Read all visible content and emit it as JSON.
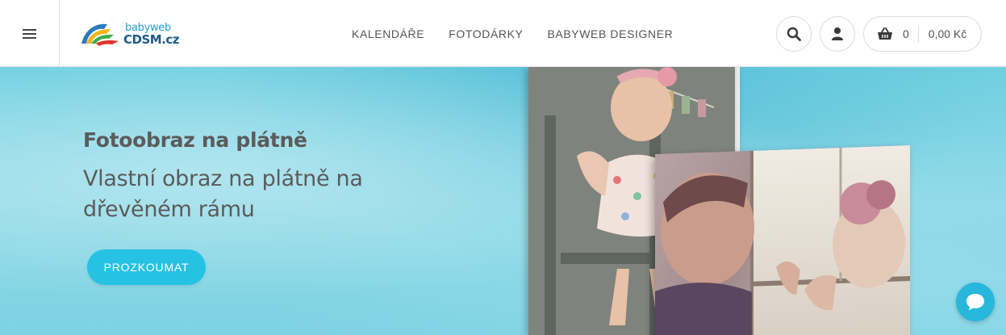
{
  "header": {
    "menu_icon": "hamburger-menu-icon",
    "logo": {
      "top_text": "babyweb",
      "bottom_text": "CDSM.cz"
    },
    "nav": [
      {
        "label": "KALENDÁŘE"
      },
      {
        "label": "FOTODÁRKY"
      },
      {
        "label": "BABYWEB DESIGNER"
      }
    ],
    "search_icon": "search-icon",
    "account_icon": "user-icon",
    "cart": {
      "icon": "basket-icon",
      "count": "0",
      "total": "0,00 Kč"
    }
  },
  "hero": {
    "title": "Fotoobraz na plátně",
    "subtitle": "Vlastní obraz na plátně na dřevěném rámu",
    "cta_label": "PROZKOUMAT"
  },
  "chat": {
    "icon": "chat-icon"
  },
  "colors": {
    "accent": "#25c2e4",
    "hero_background": "#7dd2e2",
    "text": "#5b5b5b",
    "logo_blue": "#1d5a8c"
  }
}
